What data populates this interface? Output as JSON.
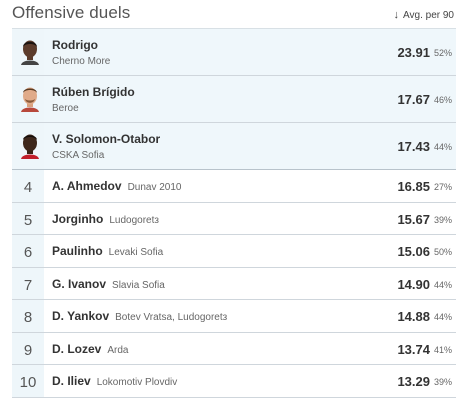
{
  "header": {
    "title": "Offensive duels",
    "sort_label": "Avg. per 90"
  },
  "top_players": [
    {
      "name": "Rodrigo",
      "team": "Cherno More",
      "value": "23.91",
      "pct": "52%",
      "avatar": "dark-skin-portrait"
    },
    {
      "name": "Rúben Brígido",
      "team": "Beroe",
      "value": "17.67",
      "pct": "46%",
      "avatar": "light-skin-portrait"
    },
    {
      "name": "V. Solomon-Otabor",
      "team": "CSKA Sofia",
      "value": "17.43",
      "pct": "44%",
      "avatar": "dark-skin-portrait"
    }
  ],
  "players": [
    {
      "rank": "4",
      "name": "A. Ahmedov",
      "team": "Dunav 2010",
      "value": "16.85",
      "pct": "27%"
    },
    {
      "rank": "5",
      "name": "Jorginho",
      "team": "Ludogoretз",
      "value": "15.67",
      "pct": "39%"
    },
    {
      "rank": "6",
      "name": "Paulinho",
      "team": "Levaki Sofia",
      "value": "15.06",
      "pct": "50%"
    },
    {
      "rank": "7",
      "name": "G. Ivanov",
      "team": "Slavia Sofia",
      "value": "14.90",
      "pct": "44%"
    },
    {
      "rank": "8",
      "name": "D. Yankov",
      "team": "Botev Vratsa, Ludogoretз",
      "value": "14.88",
      "pct": "44%"
    },
    {
      "rank": "9",
      "name": "D. Lozev",
      "team": "Arda",
      "value": "13.74",
      "pct": "41%"
    },
    {
      "rank": "10",
      "name": "D. Iliev",
      "team": "Lokomotiv Plovdiv",
      "value": "13.29",
      "pct": "39%"
    }
  ],
  "colors": {
    "top_row_bg": "#eff7fb",
    "rank_cell_bg": "#eef6fa",
    "divider": "#cfd6dc"
  }
}
